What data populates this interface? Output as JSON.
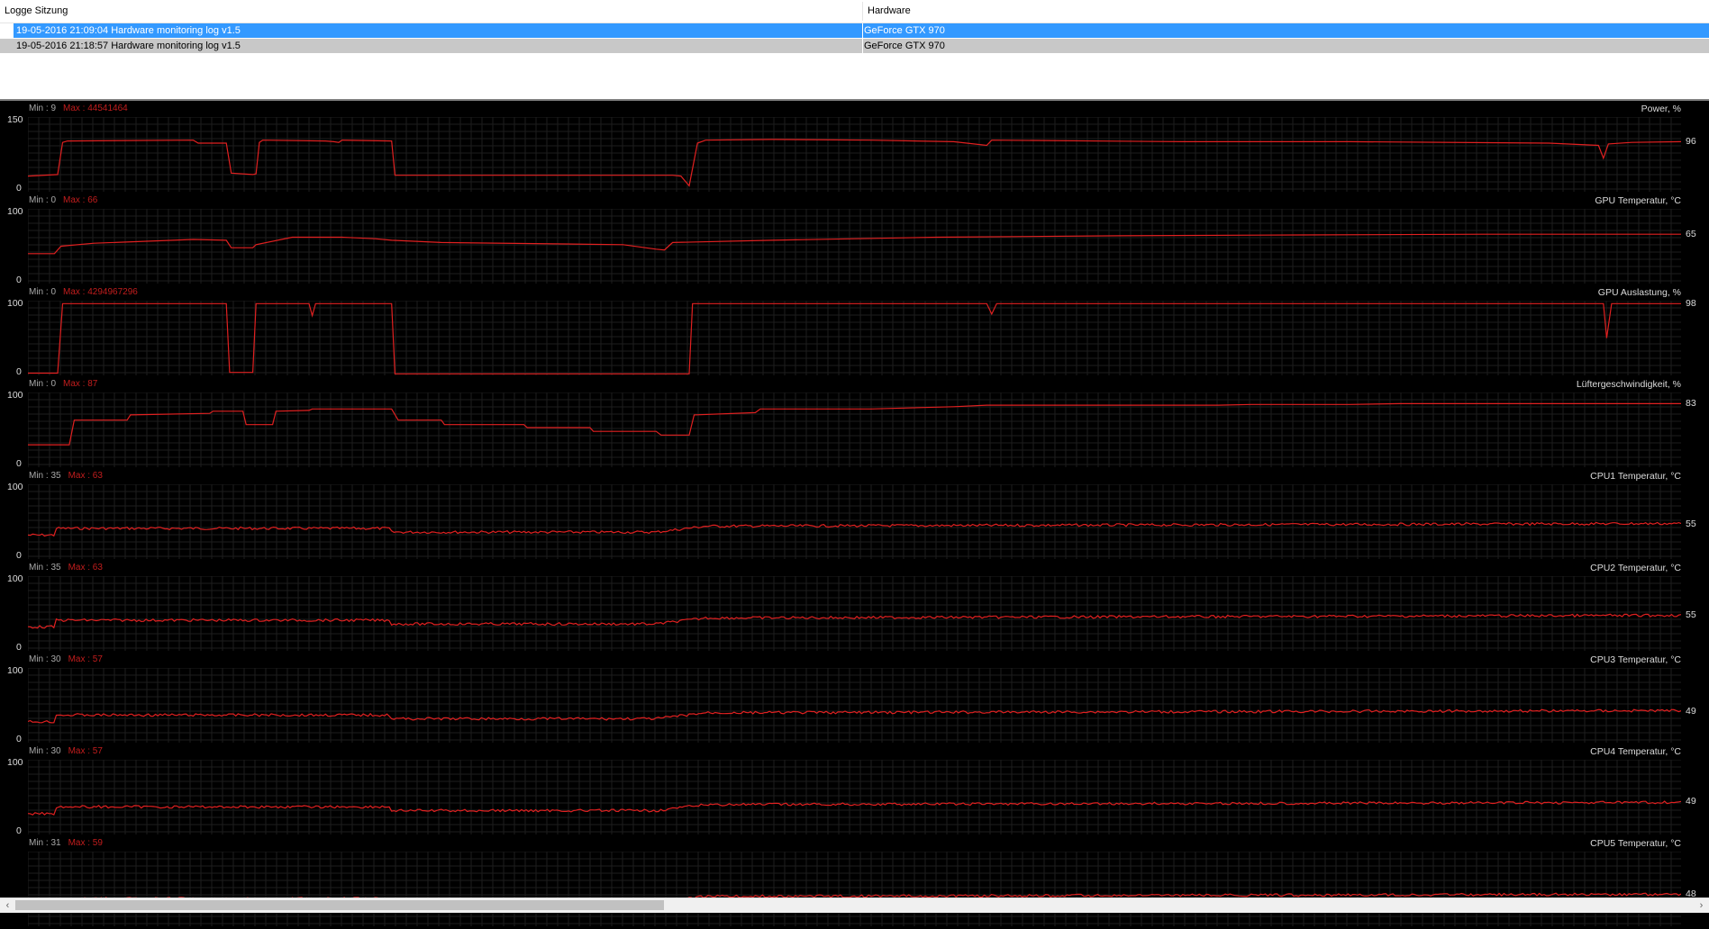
{
  "session_list": {
    "columns": [
      "Logge Sitzung",
      "Hardware"
    ],
    "rows": [
      {
        "session": "19-05-2016 21:09:04 Hardware monitoring log v1.5",
        "hardware": "GeForce GTX 970",
        "selected": true
      },
      {
        "session": "19-05-2016 21:18:57 Hardware monitoring log v1.5",
        "hardware": "GeForce GTX 970",
        "selected": false
      }
    ]
  },
  "colors": {
    "graph_line": "#e02020",
    "graph_background": "#000000",
    "grid": "#1e1e1e",
    "selection": "#3399ff"
  },
  "graphs": [
    {
      "title": "Power, %",
      "min_label": "Min : 9",
      "max_label": "Max : 44541464",
      "y_max": "150",
      "y_min": "0",
      "current": "96"
    },
    {
      "title": "GPU Temperatur, °C",
      "min_label": "Min : 0",
      "max_label": "Max : 66",
      "y_max": "100",
      "y_min": "0",
      "current": "65"
    },
    {
      "title": "GPU Auslastung, %",
      "min_label": "Min : 0",
      "max_label": "Max : 4294967296",
      "y_max": "100",
      "y_min": "0",
      "current": "98"
    },
    {
      "title": "Lüftergeschwindigkeit, %",
      "min_label": "Min : 0",
      "max_label": "Max : 87",
      "y_max": "100",
      "y_min": "0",
      "current": "83"
    },
    {
      "title": "CPU1 Temperatur, °C",
      "min_label": "Min : 35",
      "max_label": "Max : 63",
      "y_max": "100",
      "y_min": "0",
      "current": "55"
    },
    {
      "title": "CPU2 Temperatur, °C",
      "min_label": "Min : 35",
      "max_label": "Max : 63",
      "y_max": "100",
      "y_min": "0",
      "current": "55"
    },
    {
      "title": "CPU3 Temperatur, °C",
      "min_label": "Min : 30",
      "max_label": "Max : 57",
      "y_max": "100",
      "y_min": "0",
      "current": "49"
    },
    {
      "title": "CPU4 Temperatur, °C",
      "min_label": "Min : 30",
      "max_label": "Max : 57",
      "y_max": "100",
      "y_min": "0",
      "current": "49"
    },
    {
      "title": "CPU5 Temperatur, °C",
      "min_label": "Min : 31",
      "max_label": "Max : 59",
      "y_max": "",
      "y_min": "",
      "current": "48"
    }
  ],
  "scrollbar": {
    "left_arrow": "‹",
    "right_arrow": "›"
  }
}
